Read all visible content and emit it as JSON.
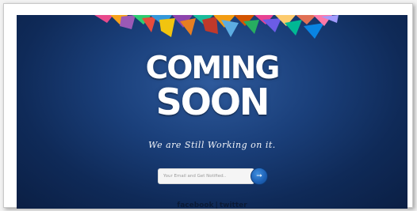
{
  "headline": {
    "line1": "COMING",
    "line2": "SOON"
  },
  "tagline": "We are Still Working on it.",
  "email": {
    "placeholder": "Your Email and Get Notified..",
    "button_icon": "arrow-right-icon"
  },
  "social": {
    "facebook": "facebook",
    "twitter": "twitter"
  },
  "colors": {
    "background": "#1a3f7a",
    "button": "#1c5fb4",
    "text": "#ffffff"
  }
}
